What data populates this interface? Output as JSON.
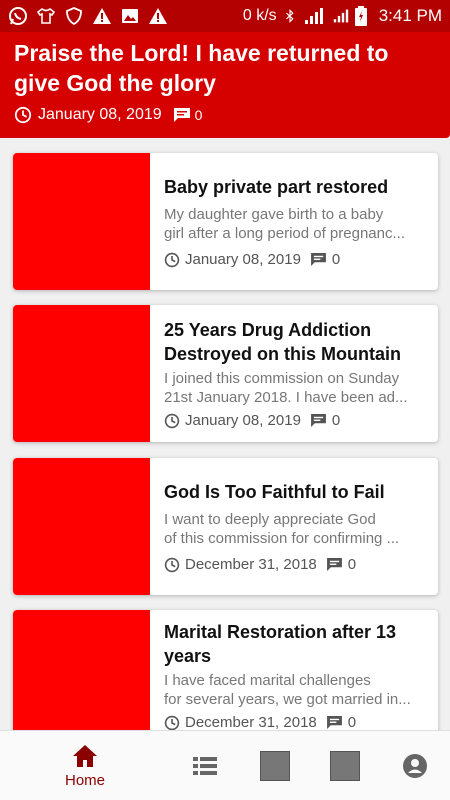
{
  "status_bar": {
    "speed": "0 k/s",
    "time": "3:41 PM"
  },
  "header": {
    "title": "Praise the Lord! I have returned to give God the glory",
    "date": "January 08, 2019",
    "comments": "0"
  },
  "cards": [
    {
      "title": "Baby private part restored",
      "excerpt_line1": "My daughter gave birth to a baby",
      "excerpt_line2": "girl after a long period of pregnanc...",
      "date": "January 08, 2019",
      "comments": "0"
    },
    {
      "title": "25 Years Drug Addiction Destroyed on this Mountain",
      "excerpt_line1": "I joined this commission on Sunday",
      "excerpt_line2": "21st January 2018. I have been ad...",
      "date": "January 08, 2019",
      "comments": "0"
    },
    {
      "title": "God Is Too Faithful to Fail",
      "excerpt_line1": "I want to deeply appreciate God",
      "excerpt_line2": "of this commission for confirming ...",
      "date": "December 31, 2018",
      "comments": "0"
    },
    {
      "title": "Marital Restoration after 13 years",
      "excerpt_line1": "I have faced marital challenges",
      "excerpt_line2": "for several years, we got married in...",
      "date": "December 31, 2018",
      "comments": "0"
    }
  ],
  "nav": {
    "home_label": "Home"
  },
  "colors": {
    "status_bar": "#b30000",
    "header": "#d50000",
    "thumbnail": "#ff0000",
    "nav_active": "#8b0000"
  }
}
